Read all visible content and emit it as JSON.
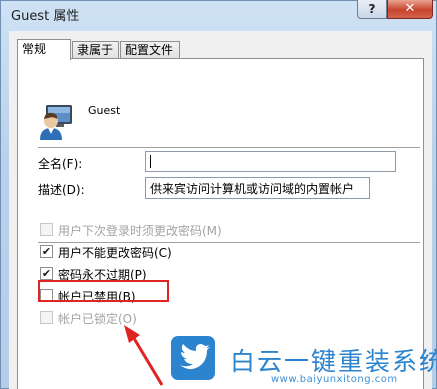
{
  "window": {
    "title": "Guest 属性",
    "help_label": "?",
    "close_label": "✕"
  },
  "tabs": [
    {
      "label": "常规",
      "active": true
    },
    {
      "label": "隶属于",
      "active": false
    },
    {
      "label": "配置文件",
      "active": false
    }
  ],
  "user": {
    "icon": "user-account-icon",
    "name": "Guest"
  },
  "fields": {
    "fullname_label": "全名(F):",
    "fullname_value": "",
    "description_label": "描述(D):",
    "description_value": "供来宾访问计算机或访问域的内置帐户"
  },
  "checkboxes": [
    {
      "label": "用户下次登录时须更改密码(M)",
      "checked": false,
      "disabled": true
    },
    {
      "label": "用户不能更改密码(C)",
      "checked": true,
      "disabled": false
    },
    {
      "label": "密码永不过期(P)",
      "checked": true,
      "disabled": false
    },
    {
      "label": "帐户已禁用(B)",
      "checked": false,
      "disabled": false
    },
    {
      "label": "帐户已锁定(O)",
      "checked": false,
      "disabled": true
    }
  ],
  "annotation": {
    "highlight_color": "#e02424"
  },
  "watermark": {
    "logo_icon": "twitter-bird-icon",
    "title": "白云一键重装系统",
    "url": "www.baiyunxitong.com",
    "color": "#2c84cf"
  }
}
